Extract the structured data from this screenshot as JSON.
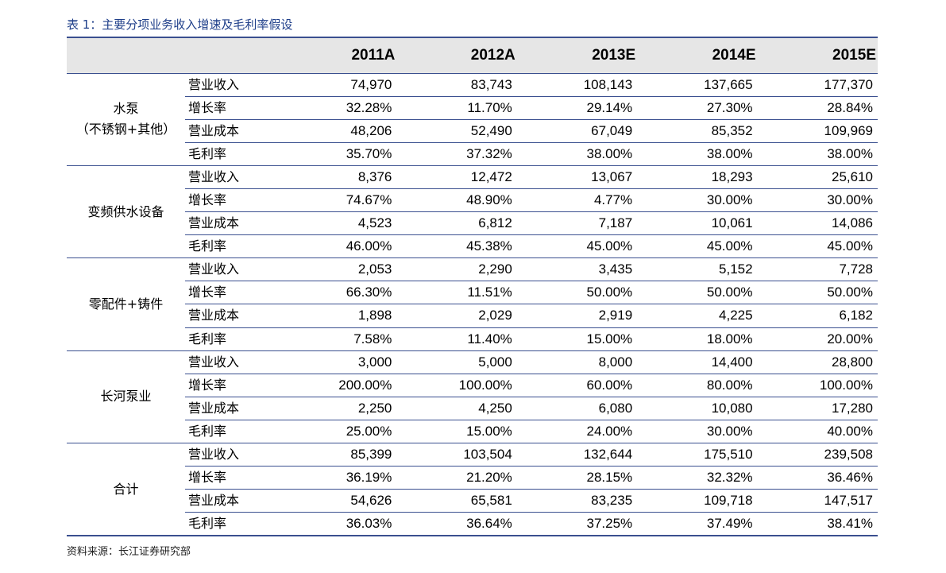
{
  "caption": "表 1：主要分项业务收入增速及毛利率假设",
  "source": "资料来源：长江证券研究部",
  "headers": [
    "2011A",
    "2012A",
    "2013E",
    "2014E",
    "2015E"
  ],
  "groups": [
    {
      "name_lines": [
        "水泵",
        "（不锈钢+其他）"
      ],
      "rows": [
        {
          "metric": "营业收入",
          "values": [
            "74,970",
            "83,743",
            "108,143",
            "137,665",
            "177,370"
          ]
        },
        {
          "metric": "增长率",
          "values": [
            "32.28%",
            "11.70%",
            "29.14%",
            "27.30%",
            "28.84%"
          ]
        },
        {
          "metric": "营业成本",
          "values": [
            "48,206",
            "52,490",
            "67,049",
            "85,352",
            "109,969"
          ]
        },
        {
          "metric": "毛利率",
          "values": [
            "35.70%",
            "37.32%",
            "38.00%",
            "38.00%",
            "38.00%"
          ]
        }
      ]
    },
    {
      "name_lines": [
        "变频供水设备"
      ],
      "rows": [
        {
          "metric": "营业收入",
          "values": [
            "8,376",
            "12,472",
            "13,067",
            "18,293",
            "25,610"
          ]
        },
        {
          "metric": "增长率",
          "values": [
            "74.67%",
            "48.90%",
            "4.77%",
            "30.00%",
            "30.00%"
          ]
        },
        {
          "metric": "营业成本",
          "values": [
            "4,523",
            "6,812",
            "7,187",
            "10,061",
            "14,086"
          ]
        },
        {
          "metric": "毛利率",
          "values": [
            "46.00%",
            "45.38%",
            "45.00%",
            "45.00%",
            "45.00%"
          ]
        }
      ]
    },
    {
      "name_lines": [
        "零配件+铸件"
      ],
      "rows": [
        {
          "metric": "营业收入",
          "values": [
            "2,053",
            "2,290",
            "3,435",
            "5,152",
            "7,728"
          ]
        },
        {
          "metric": "增长率",
          "values": [
            "66.30%",
            "11.51%",
            "50.00%",
            "50.00%",
            "50.00%"
          ]
        },
        {
          "metric": "营业成本",
          "values": [
            "1,898",
            "2,029",
            "2,919",
            "4,225",
            "6,182"
          ]
        },
        {
          "metric": "毛利率",
          "values": [
            "7.58%",
            "11.40%",
            "15.00%",
            "18.00%",
            "20.00%"
          ]
        }
      ]
    },
    {
      "name_lines": [
        "长河泵业"
      ],
      "rows": [
        {
          "metric": "营业收入",
          "values": [
            "3,000",
            "5,000",
            "8,000",
            "14,400",
            "28,800"
          ]
        },
        {
          "metric": "增长率",
          "values": [
            "200.00%",
            "100.00%",
            "60.00%",
            "80.00%",
            "100.00%"
          ]
        },
        {
          "metric": "营业成本",
          "values": [
            "2,250",
            "4,250",
            "6,080",
            "10,080",
            "17,280"
          ]
        },
        {
          "metric": "毛利率",
          "values": [
            "25.00%",
            "15.00%",
            "24.00%",
            "30.00%",
            "40.00%"
          ]
        }
      ]
    },
    {
      "name_lines": [
        "合计"
      ],
      "rows": [
        {
          "metric": "营业收入",
          "values": [
            "85,399",
            "103,504",
            "132,644",
            "175,510",
            "239,508"
          ]
        },
        {
          "metric": "增长率",
          "values": [
            "36.19%",
            "21.20%",
            "28.15%",
            "32.32%",
            "36.46%"
          ]
        },
        {
          "metric": "营业成本",
          "values": [
            "54,626",
            "65,581",
            "83,235",
            "109,718",
            "147,517"
          ]
        },
        {
          "metric": "毛利率",
          "values": [
            "36.03%",
            "36.64%",
            "37.25%",
            "37.49%",
            "38.41%"
          ]
        }
      ]
    }
  ]
}
